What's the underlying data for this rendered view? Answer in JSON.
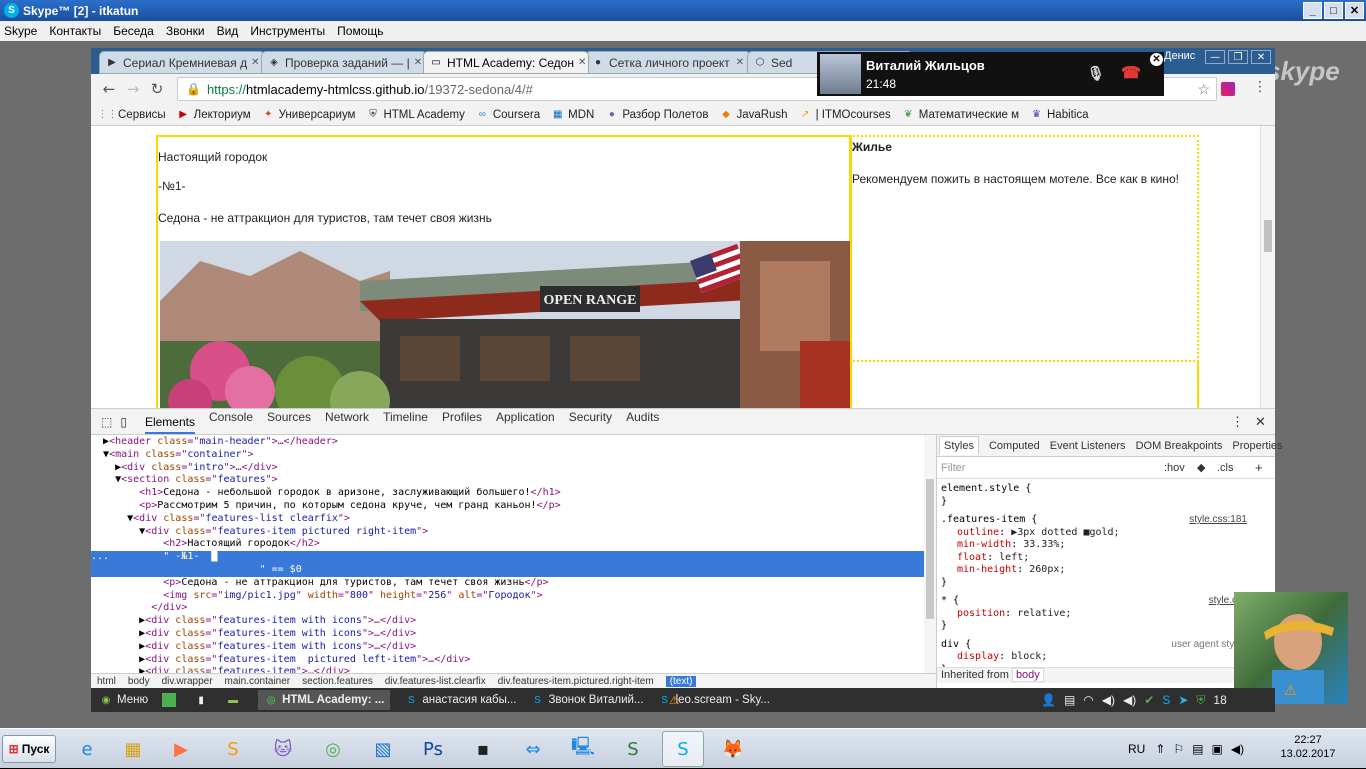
{
  "skype": {
    "title": "Skype™ [2] - itkatun",
    "menu": [
      "Skype",
      "Контакты",
      "Беседа",
      "Звонки",
      "Вид",
      "Инструменты",
      "Помощь"
    ],
    "watermark": "skype"
  },
  "chrome": {
    "tabs": [
      {
        "label": "Сериал Кремниевая д",
        "icon": "play-icon"
      },
      {
        "label": "Проверка заданий — |",
        "icon": "htmlacademy-icon"
      },
      {
        "label": "HTML Academy: Седон",
        "icon": "page-icon",
        "active": true
      },
      {
        "label": "Сетка личного проект",
        "icon": "github-icon"
      },
      {
        "label": "Sed",
        "icon": "codepen-icon"
      }
    ],
    "profile_name": "Денис",
    "url": {
      "scheme": "https://",
      "host": "htmlacademy-htmlcss.github.io",
      "path": "/19372-sedona/4/#"
    },
    "bookmarks": [
      {
        "label": "Сервисы",
        "icon": "apps-icon"
      },
      {
        "label": "Лекториум",
        "icon": "youtube-icon"
      },
      {
        "label": "Универсариум",
        "icon": "universarium-icon"
      },
      {
        "label": "HTML Academy",
        "icon": "shield-icon"
      },
      {
        "label": "Coursera",
        "icon": "coursera-icon"
      },
      {
        "label": "MDN",
        "icon": "mdn-icon"
      },
      {
        "label": "Разбор Полетов",
        "icon": "bulb-icon"
      },
      {
        "label": "JavaRush",
        "icon": "javarush-icon"
      },
      {
        "label": "| ITMOcourses",
        "icon": "itmo-icon"
      },
      {
        "label": "Математические м",
        "icon": "leaf-icon"
      },
      {
        "label": "Habitica",
        "icon": "habitica-icon"
      }
    ]
  },
  "page": {
    "left": {
      "title": "Настоящий городок",
      "number": "-№1-",
      "text": "Седона - не аттракцион для туристов, там течет своя жизнь"
    },
    "right": {
      "title": "Жилье",
      "text": "Рекомендуем пожить в настоящем мотеле. Все как в кино!"
    },
    "photo_sign": "OPEN RANGE"
  },
  "devtools": {
    "tabs": [
      "Elements",
      "Console",
      "Sources",
      "Network",
      "Timeline",
      "Profiles",
      "Application",
      "Security",
      "Audits"
    ],
    "dom_lines": [
      {
        "indent": "  ▶",
        "parts": [
          [
            "tg",
            "<header "
          ],
          [
            "at",
            "class"
          ],
          [
            "tg",
            "=\""
          ],
          [
            "av",
            "main-header"
          ],
          [
            "tg",
            "\">…</header>"
          ]
        ]
      },
      {
        "indent": "  ▼",
        "parts": [
          [
            "tg",
            "<main "
          ],
          [
            "at",
            "class"
          ],
          [
            "tg",
            "=\""
          ],
          [
            "av",
            "container"
          ],
          [
            "tg",
            "\">"
          ]
        ]
      },
      {
        "indent": "    ▶",
        "parts": [
          [
            "tg",
            "<div "
          ],
          [
            "at",
            "class"
          ],
          [
            "tg",
            "=\""
          ],
          [
            "av",
            "intro"
          ],
          [
            "tg",
            "\">…</div>"
          ]
        ]
      },
      {
        "indent": "    ▼",
        "parts": [
          [
            "tg",
            "<section "
          ],
          [
            "at",
            "class"
          ],
          [
            "tg",
            "=\""
          ],
          [
            "av",
            "features"
          ],
          [
            "tg",
            "\">"
          ]
        ]
      },
      {
        "indent": "        ",
        "parts": [
          [
            "tg",
            "<h1>"
          ],
          [
            "tx",
            "Седона - небольшой городок в аризоне, заслуживающий большего!"
          ],
          [
            "tg",
            "</h1>"
          ]
        ]
      },
      {
        "indent": "        ",
        "parts": [
          [
            "tg",
            "<p>"
          ],
          [
            "tx",
            "Рассмотрим 5 причин, по которым седона круче, чем гранд каньон!"
          ],
          [
            "tg",
            "</p>"
          ]
        ]
      },
      {
        "indent": "      ▼",
        "parts": [
          [
            "tg",
            "<div "
          ],
          [
            "at",
            "class"
          ],
          [
            "tg",
            "=\""
          ],
          [
            "av",
            "features-list clearfix"
          ],
          [
            "tg",
            "\">"
          ]
        ]
      },
      {
        "indent": "        ▼",
        "parts": [
          [
            "tg",
            "<div "
          ],
          [
            "at",
            "class"
          ],
          [
            "tg",
            "=\""
          ],
          [
            "av",
            "features-item pictured right-item"
          ],
          [
            "tg",
            "\">"
          ]
        ]
      },
      {
        "indent": "            ",
        "parts": [
          [
            "tg",
            "<h2>"
          ],
          [
            "tx",
            "Настоящий городок"
          ],
          [
            "tg",
            "</h2>"
          ]
        ]
      },
      {
        "indent": "...         ",
        "parts": [
          [
            "tx",
            "\" -№1-  █"
          ]
        ],
        "selected": true
      },
      {
        "indent": "                            ",
        "parts": [
          [
            "tx",
            "\" == $0"
          ]
        ],
        "selected": true
      },
      {
        "indent": "            ",
        "parts": [
          [
            "tg",
            "<p>"
          ],
          [
            "tx",
            "Седона - не аттракцион для туристов, там течет своя жизнь"
          ],
          [
            "tg",
            "</p>"
          ]
        ]
      },
      {
        "indent": "            ",
        "parts": [
          [
            "tg",
            "<img "
          ],
          [
            "at",
            "src"
          ],
          [
            "tg",
            "=\""
          ],
          [
            "av",
            "img/pic1.jpg"
          ],
          [
            "tg",
            "\" "
          ],
          [
            "at",
            "width"
          ],
          [
            "tg",
            "=\""
          ],
          [
            "av",
            "800"
          ],
          [
            "tg",
            "\" "
          ],
          [
            "at",
            "height"
          ],
          [
            "tg",
            "=\""
          ],
          [
            "av",
            "256"
          ],
          [
            "tg",
            "\" "
          ],
          [
            "at",
            "alt"
          ],
          [
            "tg",
            "=\""
          ],
          [
            "av",
            "Городок"
          ],
          [
            "tg",
            "\">"
          ]
        ]
      },
      {
        "indent": "          ",
        "parts": [
          [
            "tg",
            "</div>"
          ]
        ]
      },
      {
        "indent": "        ▶",
        "parts": [
          [
            "tg",
            "<div "
          ],
          [
            "at",
            "class"
          ],
          [
            "tg",
            "=\""
          ],
          [
            "av",
            "features-item with icons"
          ],
          [
            "tg",
            "\">…</div>"
          ]
        ]
      },
      {
        "indent": "        ▶",
        "parts": [
          [
            "tg",
            "<div "
          ],
          [
            "at",
            "class"
          ],
          [
            "tg",
            "=\""
          ],
          [
            "av",
            "features-item with icons"
          ],
          [
            "tg",
            "\">…</div>"
          ]
        ]
      },
      {
        "indent": "        ▶",
        "parts": [
          [
            "tg",
            "<div "
          ],
          [
            "at",
            "class"
          ],
          [
            "tg",
            "=\""
          ],
          [
            "av",
            "features-item with icons"
          ],
          [
            "tg",
            "\">…</div>"
          ]
        ]
      },
      {
        "indent": "        ▶",
        "parts": [
          [
            "tg",
            "<div "
          ],
          [
            "at",
            "class"
          ],
          [
            "tg",
            "=\""
          ],
          [
            "av",
            "features-item  pictured left-item"
          ],
          [
            "tg",
            "\">…</div>"
          ]
        ]
      },
      {
        "indent": "        ▶",
        "parts": [
          [
            "tg",
            "<div "
          ],
          [
            "at",
            "class"
          ],
          [
            "tg",
            "=\""
          ],
          [
            "av",
            "features-item"
          ],
          [
            "tg",
            "\">…</div>"
          ]
        ]
      }
    ],
    "breadcrumbs": [
      "html",
      "body",
      "div.wrapper",
      "main.container",
      "section.features",
      "div.features-list.clearfix",
      "div.features-item.pictured.right-item",
      "(text)"
    ],
    "styles_tabs": [
      "Styles",
      "Computed",
      "Event Listeners",
      "DOM Breakpoints",
      "Properties"
    ],
    "filter_placeholder": "Filter",
    "filter_hov": ":hov",
    "filter_cls": ".cls",
    "rules": [
      {
        "selector": "element.style {",
        "props": [],
        "close": "}",
        "source": ""
      },
      {
        "selector": ".features-item {",
        "source": "style.css:181",
        "props": [
          [
            "outline",
            "▶3px dotted ■gold;"
          ],
          [
            "min-width",
            "33.33%;"
          ],
          [
            "float",
            "left;"
          ],
          [
            "min-height",
            "260px;"
          ]
        ],
        "close": "}"
      },
      {
        "selector": "* {",
        "source": "style.css",
        "props": [
          [
            "position",
            "relative;"
          ]
        ],
        "close": "}"
      },
      {
        "selector": "div {",
        "source": "user agent styles",
        "props": [
          [
            "display",
            "block;"
          ]
        ],
        "close": "}"
      }
    ],
    "inherited_label": "Inherited from",
    "inherited_tag": "body"
  },
  "call": {
    "name": "Виталий Жильцов",
    "time": "21:48"
  },
  "linux_panel": {
    "menu_label": "Меню",
    "items": [
      {
        "label": "HTML Academy: ...",
        "active": true
      },
      {
        "label": "анастасия кабы..."
      },
      {
        "label": "Звонок Виталий..."
      },
      {
        "label": "leo.scream - Sky..."
      }
    ],
    "tray_number": "18"
  },
  "windows_taskbar": {
    "start_label": "Пуск",
    "lang": "RU",
    "time": "22:27",
    "date": "13.02.2017"
  },
  "colors": {
    "accent": "#3879d9",
    "outline": "#ffd700",
    "chrome_frame": "#2b5d93",
    "hangup": "#e53935"
  }
}
